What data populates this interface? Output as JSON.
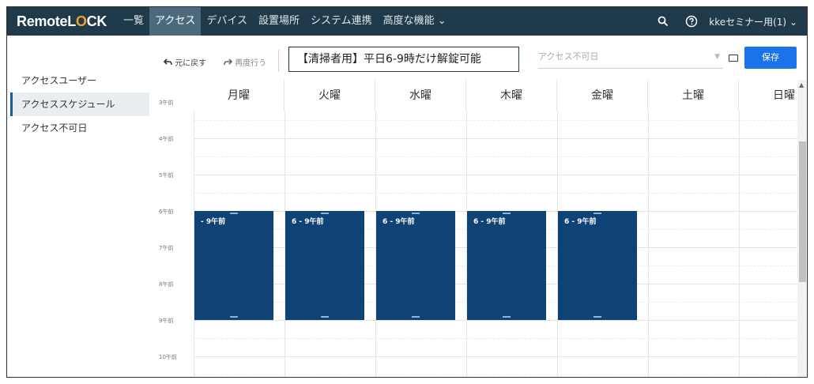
{
  "nav": {
    "logo_a": "Remote",
    "logo_b": "L",
    "logo_o": "O",
    "logo_c": "CK",
    "items": [
      "一覧",
      "アクセス",
      "デバイス",
      "設置場所",
      "システム連携",
      "高度な機能"
    ],
    "active_index": 1,
    "advanced_chevron": "⌄",
    "user": "kkeセミナー用(1)",
    "user_chevron": "⌄"
  },
  "sidebar": {
    "items": [
      "アクセスユーザー",
      "アクセススケジュール",
      "アクセス不可日"
    ],
    "active_index": 1
  },
  "toolbar": {
    "undo_label": "元に戻す",
    "redo_label": "再度行う",
    "schedule_name": "【清掃者用】平日6-9時だけ解錠可能",
    "closed_days_placeholder": "アクセス不可日",
    "save_label": "保存"
  },
  "calendar": {
    "days": [
      "月曜",
      "火曜",
      "水曜",
      "木曜",
      "金曜",
      "土曜",
      "日曜"
    ],
    "hours": [
      "3午前",
      "4午前",
      "5午前",
      "6午前",
      "7午前",
      "8午前",
      "9午前",
      "10午前"
    ],
    "events": [
      {
        "day": 0,
        "label": "- 9午前"
      },
      {
        "day": 1,
        "label": "6 - 9午前"
      },
      {
        "day": 2,
        "label": "6 - 9午前"
      },
      {
        "day": 3,
        "label": "6 - 9午前"
      },
      {
        "day": 4,
        "label": "6 - 9午前"
      }
    ]
  },
  "colors": {
    "nav_bg": "#1f3a4a",
    "nav_active": "#4b6a7c",
    "event": "#0f4375",
    "save": "#1a73e8"
  }
}
